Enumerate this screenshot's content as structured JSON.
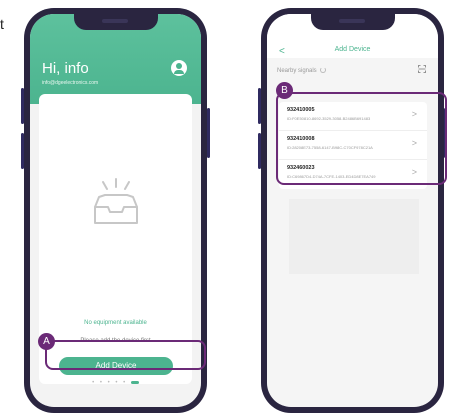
{
  "corner_text": "t",
  "left_screen": {
    "greeting": "Hi,  info",
    "email": "info@dgeelectronics.com",
    "empty_message": "No equipment available",
    "hint": "Please add the device first",
    "add_button_label": "Add Device",
    "page_dots": "• • • • •"
  },
  "right_screen": {
    "back": "<",
    "title": "Add Device",
    "nearby_label": "Nearby signals",
    "devices": [
      {
        "name": "932410005",
        "id": "ID:F0E50810-8692-3529-3058-B2486B691483"
      },
      {
        "name": "932410008",
        "id": "ID:28208E73-7558-6147-B98C-C70CF978C21A"
      },
      {
        "name": "932460023",
        "id": "ID:C69867D4-D74A-7CFE-1403-ED4D8E7EA749"
      }
    ],
    "chevron": ">"
  },
  "badges": {
    "a": "A",
    "b": "B"
  },
  "colors": {
    "brand": "#4cb48f",
    "annotation": "#6b2a77"
  }
}
